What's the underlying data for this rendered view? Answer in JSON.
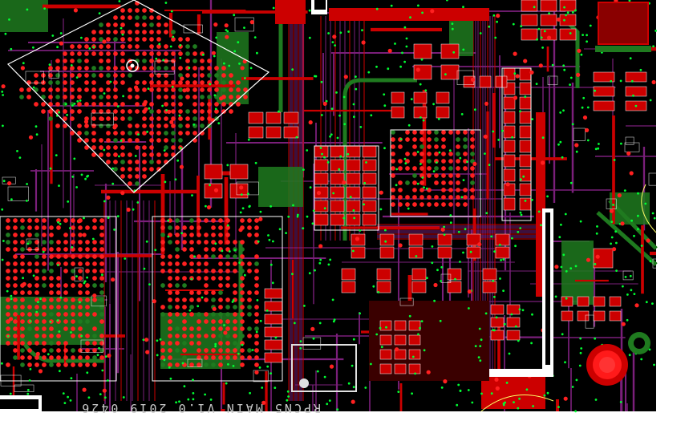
{
  "view": "PCB layout",
  "board": {
    "silkscreen_label": "RPCN5 MAIN V1.0 2019 0426",
    "colors": {
      "background": "#000000",
      "copper_top": "#cc0000",
      "copper_bright": "#ff2020",
      "copper_bottom": "#1f7a1f",
      "trace_inner": "#7a1f7a",
      "silkscreen": "#ffffff",
      "via": "#00ff33",
      "margin": "#ffffff"
    }
  }
}
